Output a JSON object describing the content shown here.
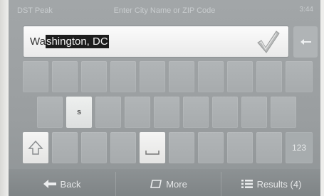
{
  "titlebar": {
    "left": "DST Peak",
    "center": "Enter City Name or ZIP Code",
    "right": "3:44"
  },
  "search": {
    "value_plain": "Wa",
    "value_selected": "shington, DC"
  },
  "keyboard": {
    "row2_highlight": "s",
    "num_key": "123"
  },
  "bottom": {
    "back_label": "Back",
    "more_label": "More",
    "results_label": "Results (4)"
  }
}
